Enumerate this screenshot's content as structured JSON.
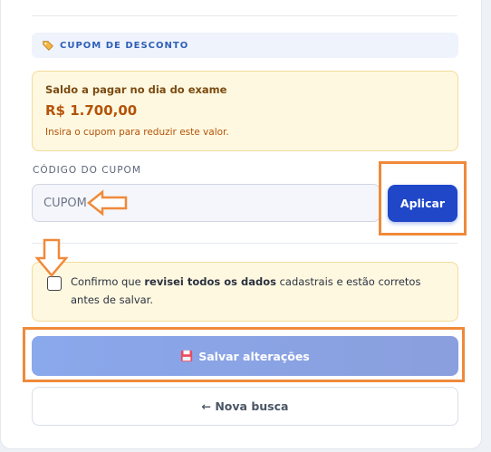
{
  "section": {
    "title": "CUPOM DE DESCONTO",
    "icon": "tag-icon"
  },
  "balance": {
    "label": "Saldo a pagar no dia do exame",
    "amount": "R$ 1.700,00",
    "hint": "Insira o cupom para reduzir este valor."
  },
  "coupon": {
    "label": "CÓDIGO DO CUPOM",
    "placeholder": "CUPOM",
    "apply_label": "Aplicar"
  },
  "confirm": {
    "prefix": "Confirmo que ",
    "bold": "revisei todos os dados",
    "suffix": " cadastrais e estão corretos antes de salvar.",
    "checked": false
  },
  "actions": {
    "save_label": "Salvar alterações",
    "back_label": "← Nova busca"
  },
  "colors": {
    "primary": "#1f47c8",
    "highlight": "#ef8a3a",
    "warning_bg": "#fff8e0",
    "amount": "#b45309"
  }
}
